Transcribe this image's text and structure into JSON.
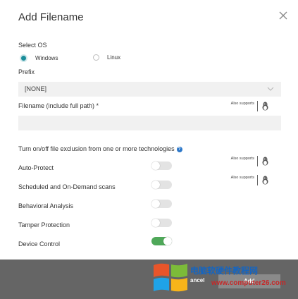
{
  "dialog": {
    "title": "Add Filename"
  },
  "os": {
    "label": "Select OS",
    "options": [
      {
        "label": "Windows",
        "selected": true
      },
      {
        "label": "Linux",
        "selected": false
      }
    ]
  },
  "prefix": {
    "label": "Prefix",
    "value": "[NONE]"
  },
  "filename": {
    "label": "Filename (include full path) *",
    "value": ""
  },
  "also_supports": "Also supports",
  "technologies": {
    "heading": "Turn on/off file exclusion from one or more technologies",
    "items": [
      {
        "label": "Auto-Protect",
        "enabled": false
      },
      {
        "label": "Scheduled and On-Demand scans",
        "enabled": false
      },
      {
        "label": "Behavioral Analysis",
        "enabled": false
      },
      {
        "label": "Tamper Protection",
        "enabled": false
      },
      {
        "label": "Device Control",
        "enabled": true
      }
    ]
  },
  "footer": {
    "cancel_label": "ancel",
    "add_label": "Add"
  },
  "watermark": {
    "line1": "电脑软硬件教程网",
    "line2": "www.computer26.com"
  },
  "colors": {
    "accent": "#1a8d9a",
    "toggle_on": "#4fa859",
    "footer_bg": "#656565",
    "info": "#2d78c9"
  }
}
